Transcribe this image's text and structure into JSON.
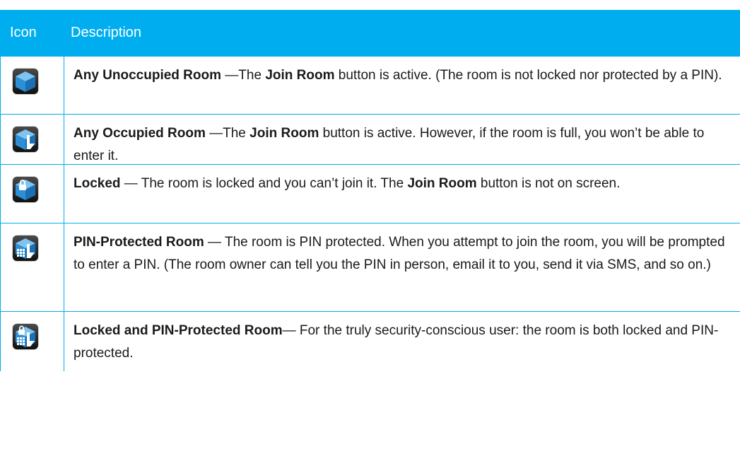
{
  "header": {
    "icon": "Icon",
    "description": "Description"
  },
  "rows": [
    {
      "icon": "room-unoccupied-icon",
      "title": "Any Unoccupied Room",
      "t1": " —The ",
      "b1": "Join Room",
      "t2": " button is active. (The room is not locked nor protected by a PIN)."
    },
    {
      "icon": "room-occupied-icon",
      "title": "Any Occupied Room",
      "t1": " —The ",
      "b1": "Join Room",
      "t2": " button is active. However, if the room is full, you won’t be able to enter it."
    },
    {
      "icon": "room-locked-icon",
      "title": "Locked",
      "t1": " — The room is locked and you can’t join it. The ",
      "b1": "Join Room",
      "t2": " button is not on screen."
    },
    {
      "icon": "room-pin-protected-icon",
      "title": "PIN-Protected Room",
      "t1": " — The room is PIN protected. When you attempt to join the room, you will be prompted to enter a PIN. (The room owner can tell you the PIN in person, email it to you, send it via SMS, and so on.)"
    },
    {
      "icon": "room-locked-pin-icon",
      "title": "Locked and PIN-Protected Room",
      "t1": "— For the truly security-conscious user: the room is both locked and PIN-protected."
    }
  ],
  "colors": {
    "accent": "#00aeef",
    "header_text": "#ffffff",
    "cube": "#2e8fd8"
  }
}
